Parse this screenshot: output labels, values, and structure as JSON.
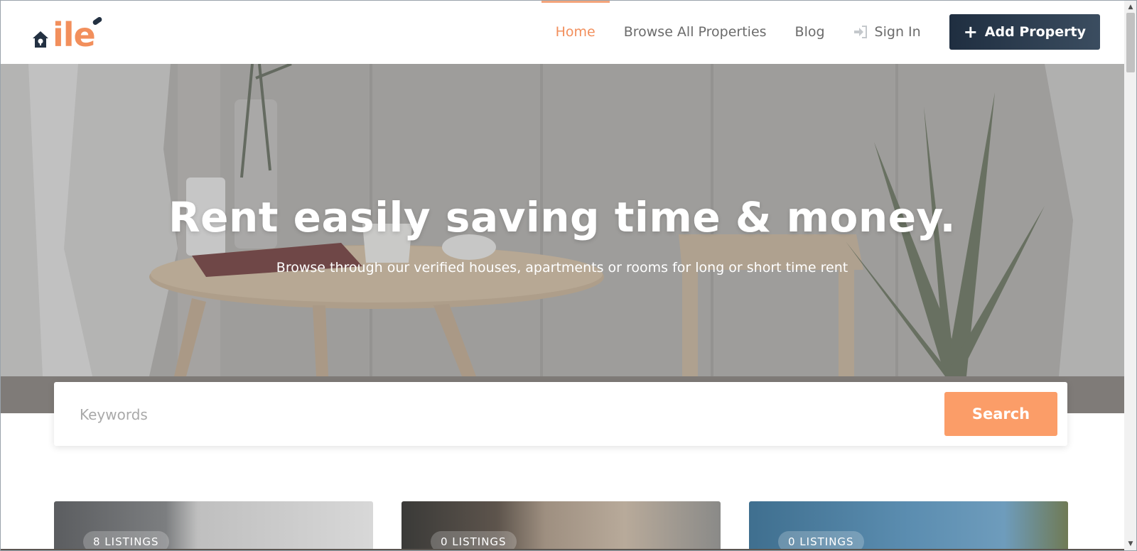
{
  "logo": {
    "text": "ile"
  },
  "nav": {
    "items": [
      {
        "label": "Home",
        "active": true
      },
      {
        "label": "Browse All Properties",
        "active": false
      },
      {
        "label": "Blog",
        "active": false
      }
    ],
    "signin_label": "Sign In",
    "add_property_label": "Add Property"
  },
  "hero": {
    "title": "Rent easily saving time & money.",
    "subtitle": "Browse through our verified houses, apartments or rooms for long or short time rent"
  },
  "search": {
    "placeholder": "Keywords",
    "button_label": "Search"
  },
  "cards": [
    {
      "badge": "8 LISTINGS"
    },
    {
      "badge": "0 LISTINGS"
    },
    {
      "badge": "0 LISTINGS"
    }
  ],
  "colors": {
    "accent": "#f28f5c",
    "button_dark": "#233142",
    "search_button": "#fb9d68"
  }
}
